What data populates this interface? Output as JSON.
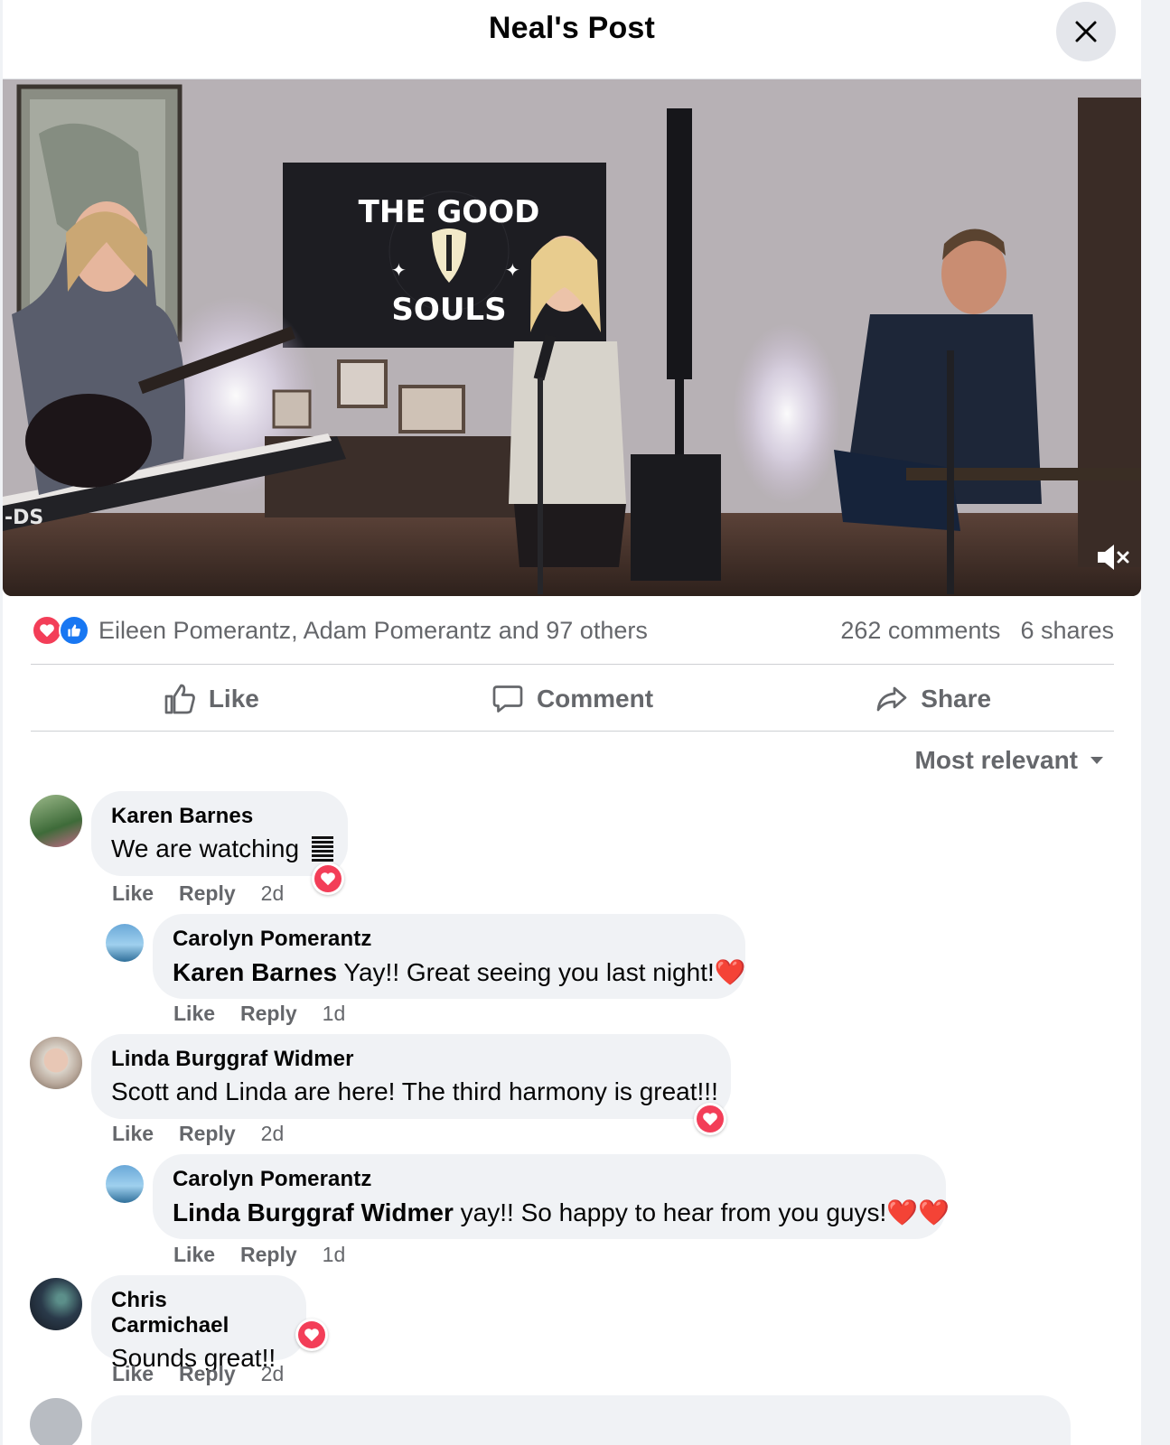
{
  "dialog": {
    "title": "Neal's Post"
  },
  "video": {
    "sign_top": "THE GOOD",
    "sign_bottom": "SOULS",
    "keyboard_brand": "-DS"
  },
  "stats": {
    "reactions_text": "Eileen Pomerantz, Adam Pomerantz and 97 others",
    "comments": "262 comments",
    "shares": "6 shares"
  },
  "actions": {
    "like": "Like",
    "comment": "Comment",
    "share": "Share"
  },
  "sort": {
    "label": "Most relevant"
  },
  "comments": [
    {
      "author": "Karen Barnes",
      "mention": "",
      "text": "We are watching",
      "emoji": "",
      "like": "Like",
      "reply": "Reply",
      "time": "2d"
    },
    {
      "author": "Carolyn Pomerantz",
      "mention": "Karen Barnes",
      "text": "Yay!! Great seeing you last night!",
      "emoji": "❤️",
      "like": "Like",
      "reply": "Reply",
      "time": "1d"
    },
    {
      "author": "Linda Burggraf Widmer",
      "mention": "",
      "text": "Scott and Linda are here! The third harmony is great!!!",
      "emoji": "",
      "like": "Like",
      "reply": "Reply",
      "time": "2d"
    },
    {
      "author": "Carolyn Pomerantz",
      "mention": "Linda Burggraf Widmer",
      "text": "yay!! So happy to hear from you guys!",
      "emoji": "❤️❤️",
      "like": "Like",
      "reply": "Reply",
      "time": "1d"
    },
    {
      "author": "Chris Carmichael",
      "mention": "",
      "text": "Sounds great!!",
      "emoji": "",
      "like": "Like",
      "reply": "Reply",
      "time": "2d"
    }
  ],
  "colors": {
    "love": "#f33e58",
    "like": "#1877f2",
    "secondary_text": "#65676b",
    "bubble": "#f0f2f5"
  }
}
